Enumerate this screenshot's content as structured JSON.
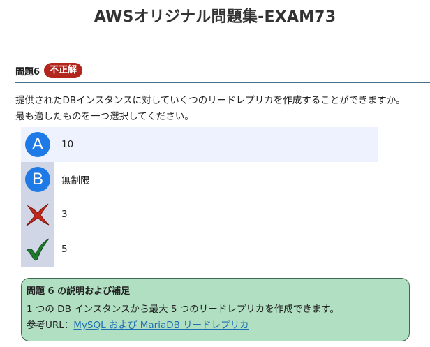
{
  "page": {
    "title": "AWSオリジナル問題集-EXAM73"
  },
  "question": {
    "number_label": "問題6",
    "result_badge": "不正解",
    "text": "提供されたDBインスタンスに対していくつのリードレプリカを作成することができますか。最も適したものを一つ選択してください。"
  },
  "choices": [
    {
      "marker": "A",
      "marker_icon": "letter-a-circle-icon",
      "text": "10",
      "selected": true
    },
    {
      "marker": "B",
      "marker_icon": "letter-b-circle-icon",
      "text": "無制限",
      "selected": false
    },
    {
      "marker": "",
      "marker_icon": "red-x-icon",
      "text": "3",
      "selected": false
    },
    {
      "marker": "",
      "marker_icon": "green-check-icon",
      "text": "5",
      "selected": false
    }
  ],
  "explanation": {
    "title": "問題 6 の説明および補足",
    "body": "1 つの DB インスタンスから最大 5 つのリードレプリカを作成できます。",
    "ref_label": "参考URL：",
    "ref_link": "MySQL および MariaDB リードレプリカ"
  },
  "colors": {
    "badge": "#b3261e",
    "circle": "#1e7ae6",
    "selected_row": "#eef2ff",
    "marker_col": "#d0d6e6",
    "explain_bg": "#b0dfc1",
    "link": "#1e6fb3"
  }
}
